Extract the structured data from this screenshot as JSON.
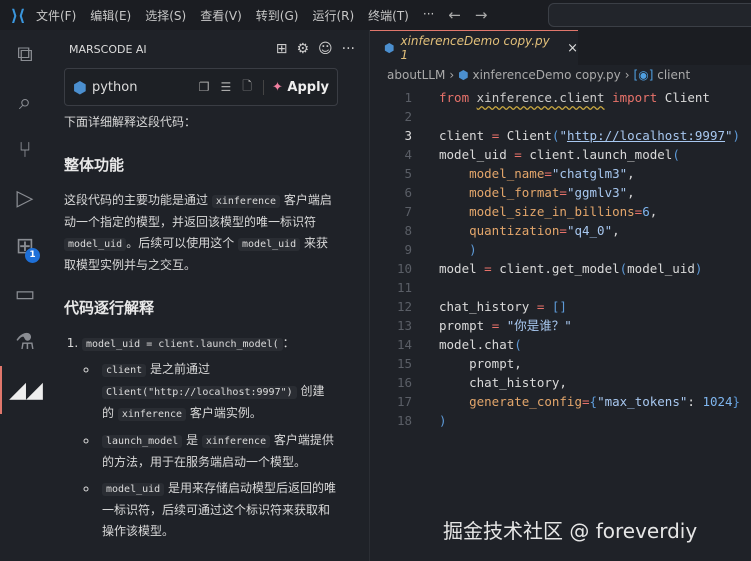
{
  "titlebar": {
    "menus": [
      "文件(F)",
      "编辑(E)",
      "选择(S)",
      "查看(V)",
      "转到(G)",
      "运行(R)",
      "终端(T)",
      "···"
    ],
    "back": "←",
    "forward": "→"
  },
  "activity": {
    "items": [
      "explorer-icon",
      "search-icon",
      "source-control-icon",
      "run-debug-icon",
      "extensions-icon",
      "remote-explorer-icon",
      "testing-icon",
      "marscode-icon"
    ],
    "extensions_badge": "1"
  },
  "sidebar": {
    "title": "MARSCODE AI",
    "codeblock": {
      "language": "python",
      "apply_label": "Apply"
    },
    "intro": "下面详细解释这段代码：",
    "h1": "整体功能",
    "p1": [
      [
        "这段代码的主要功能是通过 ",
        "t"
      ],
      [
        "xinference",
        "c"
      ],
      [
        " 客户端启动一个指定的模型，并返回该模型的唯一标识符 ",
        "t"
      ],
      [
        "model_uid",
        "c"
      ],
      [
        "。后续可以使用这个 ",
        "t"
      ],
      [
        "model_uid",
        "c"
      ],
      [
        " 来获取模型实例并与之交互。",
        "t"
      ]
    ],
    "h2": "代码逐行解释",
    "item1": [
      [
        "model_uid = client.launch_model(",
        "c"
      ],
      [
        "：",
        "t"
      ]
    ],
    "bullets": [
      [
        [
          "client",
          "c"
        ],
        [
          " 是之前通过 ",
          "t"
        ],
        [
          "Client(\"http://localhost:9997\")",
          "c"
        ],
        [
          " 创建的 ",
          "t"
        ],
        [
          "xinference",
          "c"
        ],
        [
          " 客户端实例。",
          "t"
        ]
      ],
      [
        [
          "launch_model",
          "c"
        ],
        [
          " 是 ",
          "t"
        ],
        [
          "xinference",
          "c"
        ],
        [
          " 客户端提供的方法，用于在服务端启动一个模型。",
          "t"
        ]
      ],
      [
        [
          "model_uid",
          "c"
        ],
        [
          " 是用来存储启动模型后返回的唯一标识符，后续可通过这个标识符来获取和操作该模型。",
          "t"
        ]
      ]
    ]
  },
  "editor": {
    "tab": {
      "name": "xinferenceDemo copy.py",
      "problems": "1",
      "close": "×"
    },
    "breadcrumb": [
      "aboutLLM",
      "xinferenceDemo copy.py",
      "client"
    ],
    "current_line": 3,
    "lines": [
      [
        [
          "from",
          "kw"
        ],
        [
          " ",
          "id"
        ],
        [
          "xinference.client",
          "sq"
        ],
        [
          " ",
          "id"
        ],
        [
          "import",
          "kw"
        ],
        [
          " Client",
          "id"
        ]
      ],
      [],
      [
        [
          "client ",
          "id"
        ],
        [
          "=",
          "op"
        ],
        [
          " Client",
          "id"
        ],
        [
          "(",
          "pn"
        ],
        [
          "\"",
          "st"
        ],
        [
          "http://localhost:9997",
          "url"
        ],
        [
          "\"",
          "st"
        ],
        [
          ")",
          "pn"
        ]
      ],
      [
        [
          "model_uid ",
          "id"
        ],
        [
          "=",
          "op"
        ],
        [
          " client.launch_model",
          "id"
        ],
        [
          "(",
          "pn"
        ]
      ],
      [
        [
          "    model_name",
          "pa"
        ],
        [
          "=",
          "op"
        ],
        [
          "\"chatglm3\"",
          "st"
        ],
        [
          ",",
          "id"
        ]
      ],
      [
        [
          "    model_format",
          "pa"
        ],
        [
          "=",
          "op"
        ],
        [
          "\"ggmlv3\"",
          "st"
        ],
        [
          ",",
          "id"
        ]
      ],
      [
        [
          "    model_size_in_billions",
          "pa"
        ],
        [
          "=",
          "op"
        ],
        [
          "6",
          "nu"
        ],
        [
          ",",
          "id"
        ]
      ],
      [
        [
          "    quantization",
          "pa"
        ],
        [
          "=",
          "op"
        ],
        [
          "\"q4_0\"",
          "st"
        ],
        [
          ",",
          "id"
        ]
      ],
      [
        [
          "    )",
          "pn"
        ]
      ],
      [
        [
          "model ",
          "id"
        ],
        [
          "=",
          "op"
        ],
        [
          " client.get_model",
          "id"
        ],
        [
          "(",
          "pn"
        ],
        [
          "model_uid",
          "id"
        ],
        [
          ")",
          "pn"
        ]
      ],
      [],
      [
        [
          "chat_history ",
          "id"
        ],
        [
          "=",
          "op"
        ],
        [
          " ",
          "id"
        ],
        [
          "[]",
          "pn"
        ]
      ],
      [
        [
          "prompt ",
          "id"
        ],
        [
          "=",
          "op"
        ],
        [
          " ",
          "id"
        ],
        [
          "\"你是谁？\"",
          "st"
        ]
      ],
      [
        [
          "model.chat",
          "id"
        ],
        [
          "(",
          "pn"
        ]
      ],
      [
        [
          "    prompt,",
          "id"
        ]
      ],
      [
        [
          "    chat_history,",
          "id"
        ]
      ],
      [
        [
          "    generate_config",
          "pa"
        ],
        [
          "=",
          "op"
        ],
        [
          "{",
          "pn"
        ],
        [
          "\"max_tokens\"",
          "st"
        ],
        [
          ": ",
          "id"
        ],
        [
          "1024",
          "nu"
        ],
        [
          "}",
          "pn"
        ]
      ],
      [
        [
          ")",
          "pn"
        ]
      ]
    ]
  },
  "watermark": "掘金技术社区 @ foreverdiy"
}
